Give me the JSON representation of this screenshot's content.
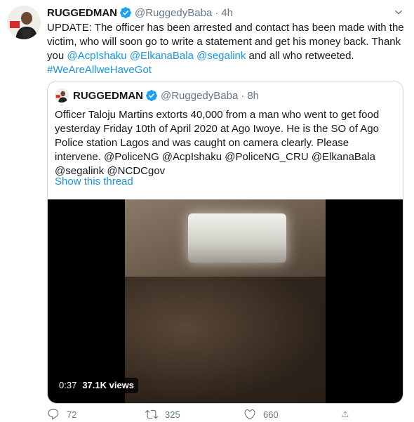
{
  "tweet": {
    "author_name": "RUGGEDMAN",
    "author_handle": "@RuggedyBaba",
    "separator": "·",
    "time": "4h",
    "text_parts": {
      "p1": "UPDATE: The officer has been arrested and contact has been made with the victim, who will soon go to write a statement and get his money back. Thank you ",
      "m1": "@AcpIshaku",
      "m2": "@ElkanaBala",
      "m3": "@segalink",
      "p2": " and all who retweeted.",
      "hashtag": "#WeAreAllweHaveGot"
    }
  },
  "quoted": {
    "author_name": "RUGGEDMAN",
    "author_handle": "@RuggedyBaba",
    "separator": "·",
    "time": "8h",
    "text": "Officer Taloju Martins extorts 40,000 from a man who went to get food yesterday Friday 10th of April 2020 at Ago Iwoye. He is the SO of Ago Police station Lagos and was caught on camera clearly. Please intervene. @PoliceNG @AcpIshaku @PoliceNG_CRU @ElkanaBala @segalink @NCDCgov",
    "show_thread": "Show this thread",
    "video": {
      "duration": "0:37",
      "views": "37.1K views"
    }
  },
  "actions": {
    "reply_count": "72",
    "retweet_count": "325",
    "like_count": "660"
  },
  "icons": {
    "verified": "verified-badge-icon",
    "reply": "reply-icon",
    "retweet": "retweet-icon",
    "like": "like-icon",
    "share": "share-icon",
    "more": "chevron-down-icon"
  },
  "colors": {
    "link": "#1b95e0",
    "muted": "#657786",
    "verified": "#1da1f2",
    "border": "#ccd6dd"
  }
}
